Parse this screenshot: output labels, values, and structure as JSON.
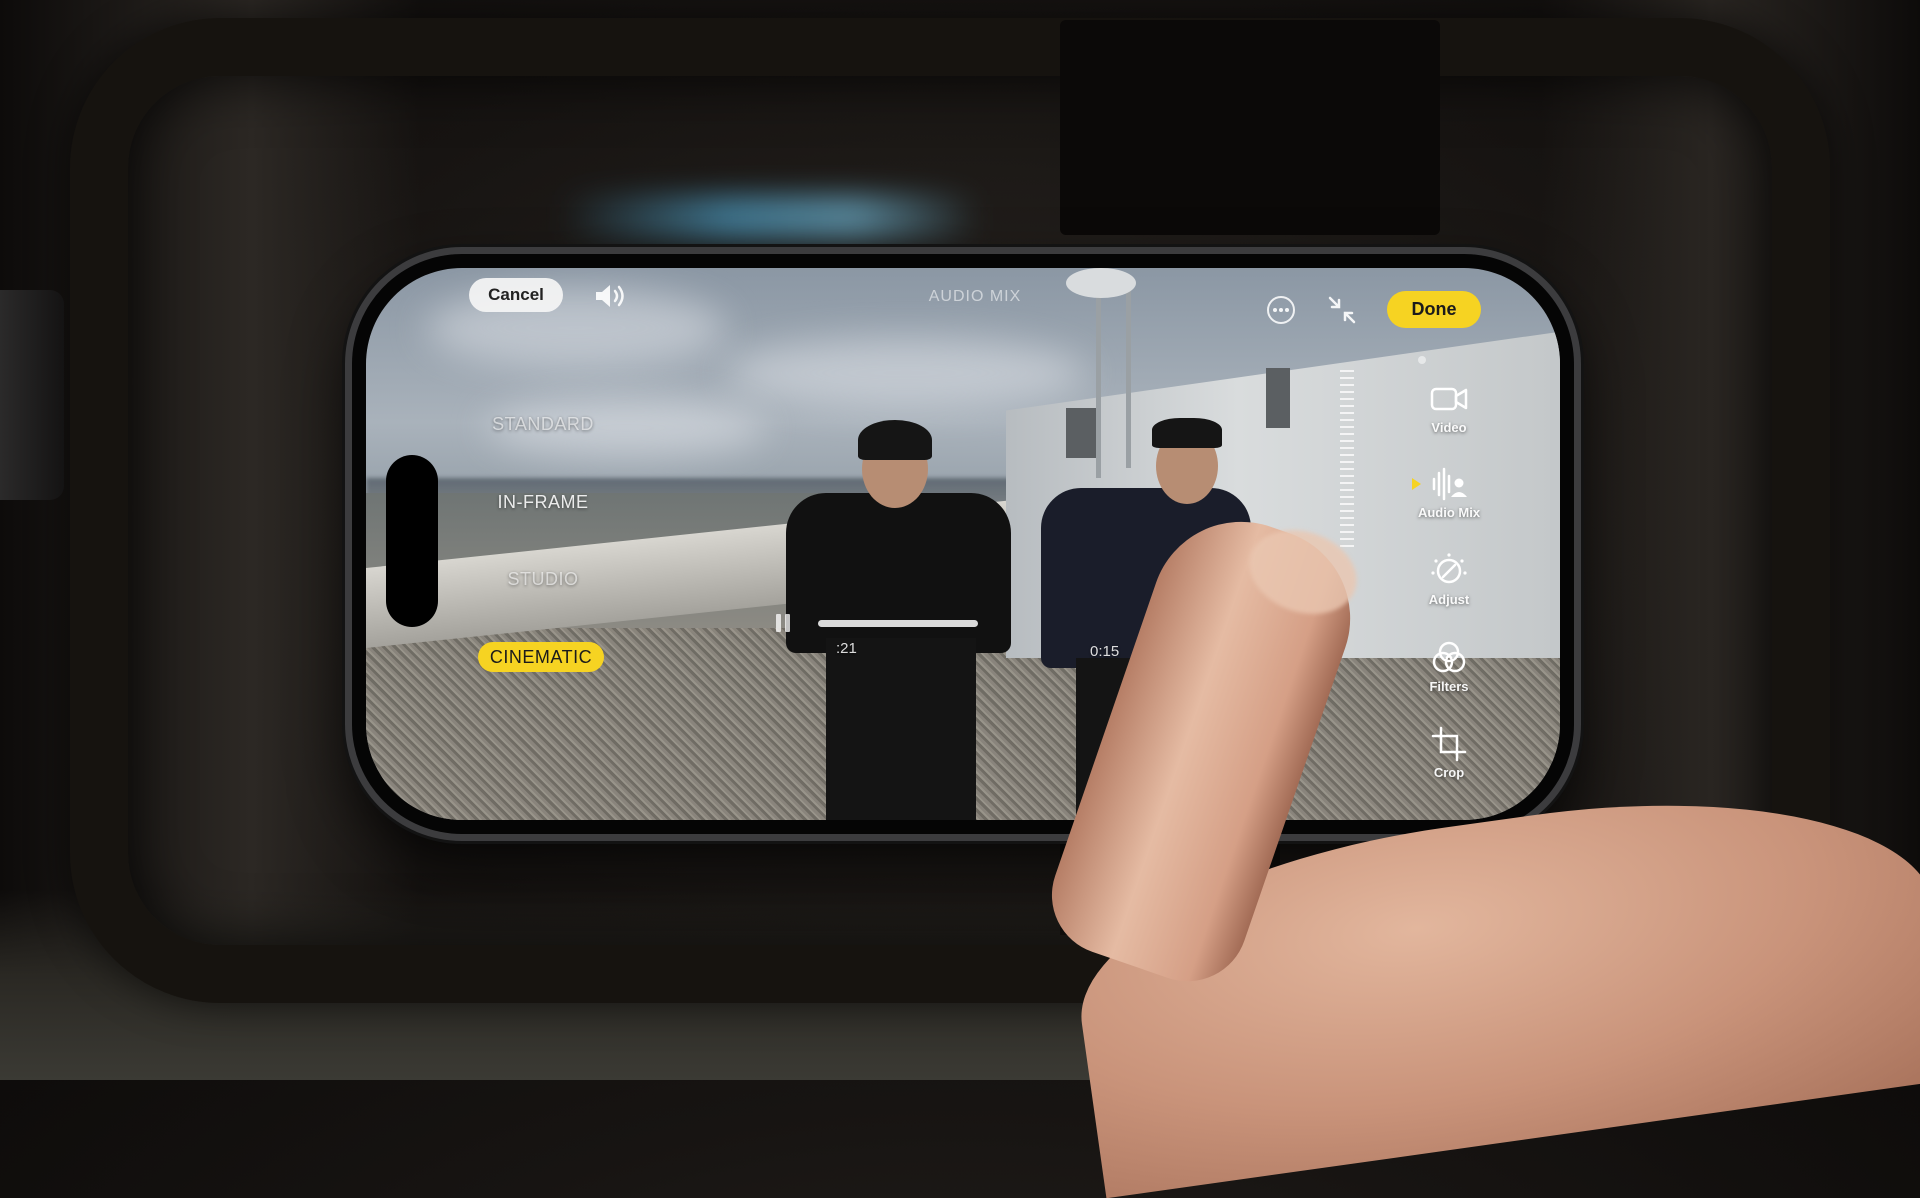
{
  "header": {
    "cancel_label": "Cancel",
    "mode_title": "AUDIO MIX",
    "done_label": "Done"
  },
  "audio_mix": {
    "options": [
      {
        "label": "STANDARD",
        "selected": false
      },
      {
        "label": "IN-FRAME",
        "selected": false
      },
      {
        "label": "STUDIO",
        "selected": false
      },
      {
        "label": "CINEMATIC",
        "selected": true
      }
    ]
  },
  "playback": {
    "current_time": ":21",
    "end_time": "0:15",
    "state": "playing"
  },
  "tools": [
    {
      "label": "Video",
      "icon": "video-camera-icon",
      "active": false
    },
    {
      "label": "Audio Mix",
      "icon": "audio-mix-icon",
      "active": true
    },
    {
      "label": "Adjust",
      "icon": "adjust-dial-icon",
      "active": false
    },
    {
      "label": "Filters",
      "icon": "filters-icon",
      "active": false
    },
    {
      "label": "Crop",
      "icon": "crop-icon",
      "active": false
    }
  ],
  "colors": {
    "accent": "#f6d322",
    "cancel_bg": "#f5f5f5"
  }
}
